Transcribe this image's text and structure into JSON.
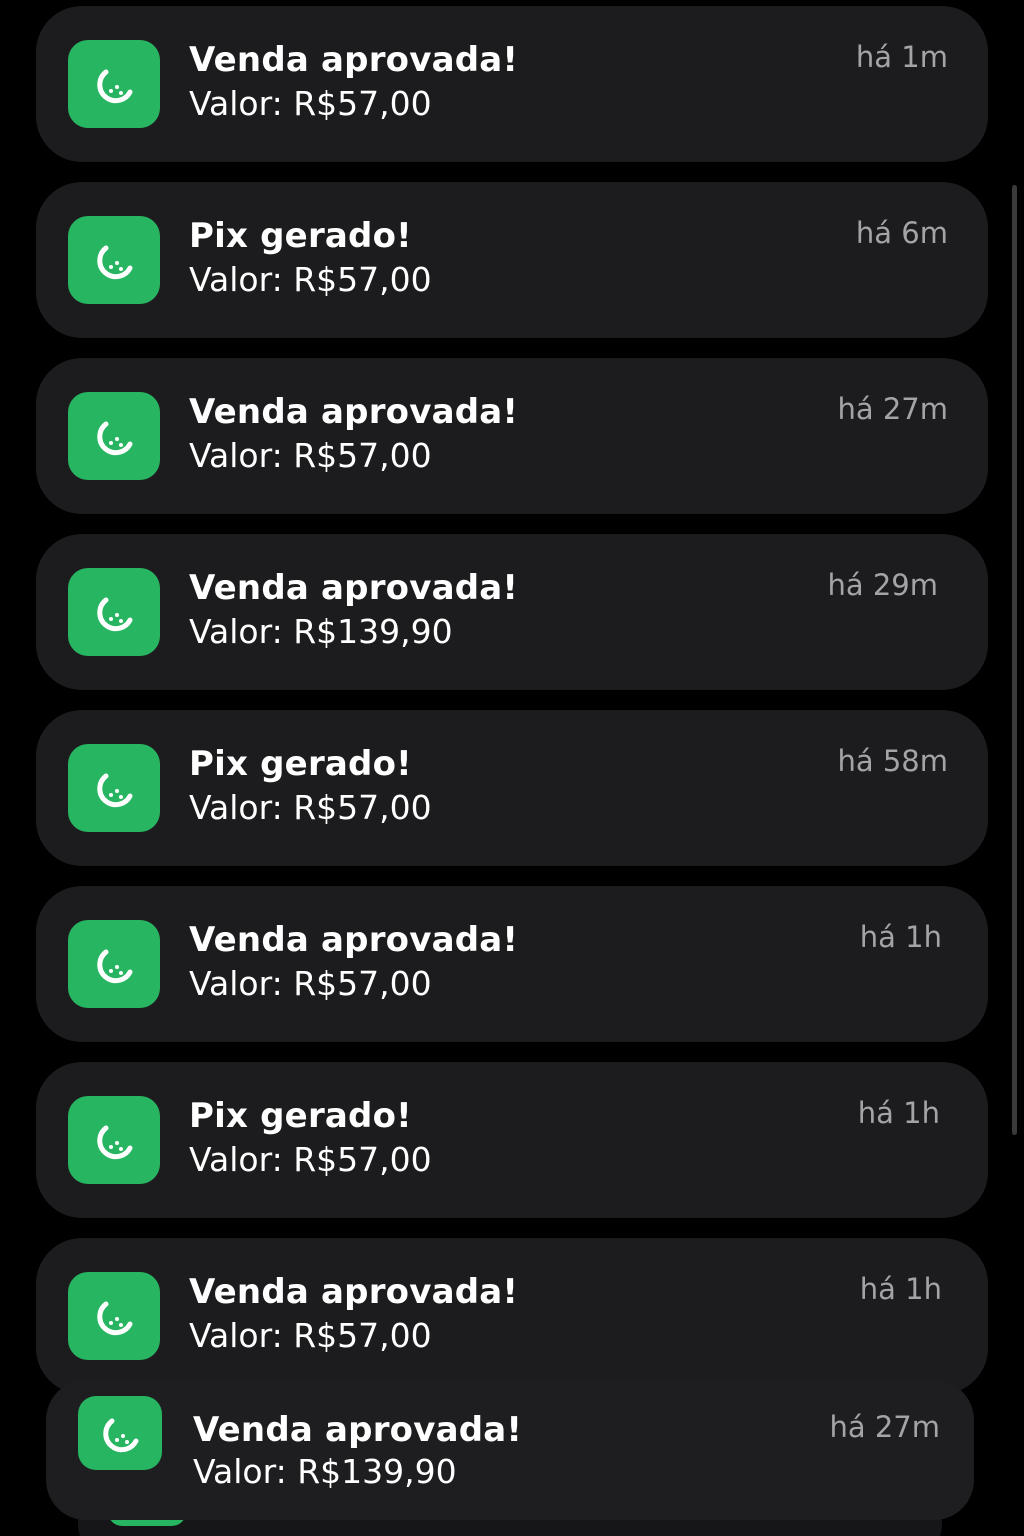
{
  "notifications": [
    {
      "title": "Venda aprovada!",
      "value": "Valor: R$57,00",
      "time": "há 1m"
    },
    {
      "title": "Pix gerado!",
      "value": "Valor: R$57,00",
      "time": "há 6m"
    },
    {
      "title": "Venda aprovada!",
      "value": "Valor: R$57,00",
      "time": "há 27m"
    },
    {
      "title": "Venda aprovada!",
      "value": "Valor: R$139,90",
      "time": "há 29m"
    },
    {
      "title": "Pix gerado!",
      "value": "Valor: R$57,00",
      "time": "há 58m"
    },
    {
      "title": "Venda aprovada!",
      "value": "Valor: R$57,00",
      "time": "há 1h"
    },
    {
      "title": "Pix gerado!",
      "value": "Valor: R$57,00",
      "time": "há 1h"
    },
    {
      "title": "Venda aprovada!",
      "value": "Valor: R$57,00",
      "time": "há 1h"
    },
    {
      "title": "Venda aprovada!",
      "value": "Valor: R$139,90",
      "time": "há 27m"
    }
  ],
  "app_icon": {
    "name": "lime-slice-icon",
    "color": "#27b561"
  }
}
